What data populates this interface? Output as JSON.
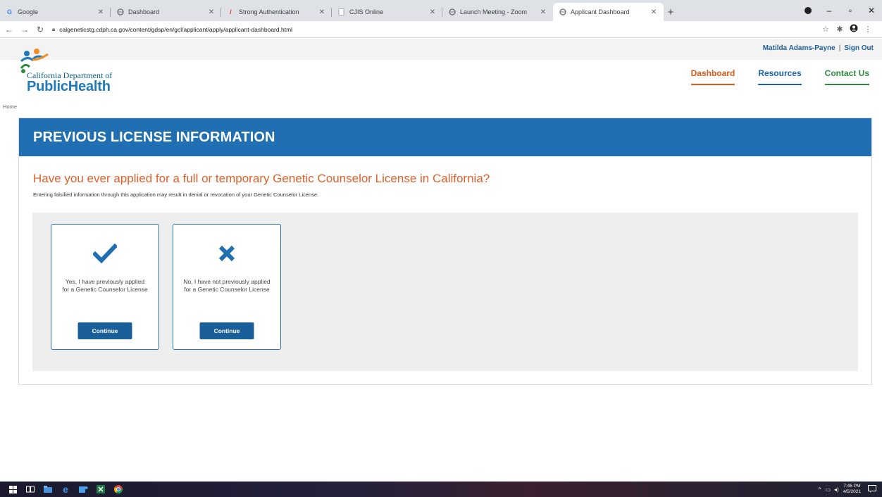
{
  "browser": {
    "tabs": [
      {
        "title": "Google",
        "icon": "google-icon",
        "active": false
      },
      {
        "title": "Dashboard",
        "icon": "globe-icon",
        "active": false
      },
      {
        "title": "Strong Authentication",
        "icon": "auth-icon",
        "active": false
      },
      {
        "title": "CJIS Online",
        "icon": "page-icon",
        "active": false
      },
      {
        "title": "Launch Meeting - Zoom",
        "icon": "globe-icon",
        "active": false
      },
      {
        "title": "Applicant Dashboard",
        "icon": "globe-icon",
        "active": true
      }
    ],
    "url": "calgeneticstg.cdph.ca.gov/content/gdsp/en/gcl/applicant/apply/applicant-dashboard.html"
  },
  "header": {
    "user_name": "Matilda Adams-Payne",
    "separator": "|",
    "sign_out": "Sign Out",
    "logo_line1": "California Department of",
    "logo_line2": "PublicHealth",
    "nav": {
      "dashboard": "Dashboard",
      "resources": "Resources",
      "contact": "Contact Us"
    },
    "breadcrumb": "Home"
  },
  "panel": {
    "title": "PREVIOUS LICENSE INFORMATION",
    "question": "Have you ever applied for a full or temporary Genetic Counselor License in California?",
    "warning": "Entering falsified information through this application may result in denial or revocation of your Genetic Counselor License.",
    "options": [
      {
        "text": "Yes, I have previously applied for a Genetic Counselor License",
        "button": "Continue",
        "icon": "checkmark-icon"
      },
      {
        "text": "No, I have not previously applied for a Genetic Counselor License",
        "button": "Continue",
        "icon": "x-icon"
      }
    ]
  },
  "taskbar": {
    "time": "7:46 PM",
    "date": "4/5/2021"
  },
  "colors": {
    "header_blue": "#1f6fb2",
    "question_orange": "#e0602a",
    "button_blue": "#1a5f99",
    "nav_dashboard": "#e05a1a",
    "nav_resources": "#1a66b3",
    "nav_contact": "#2e8b3d"
  }
}
